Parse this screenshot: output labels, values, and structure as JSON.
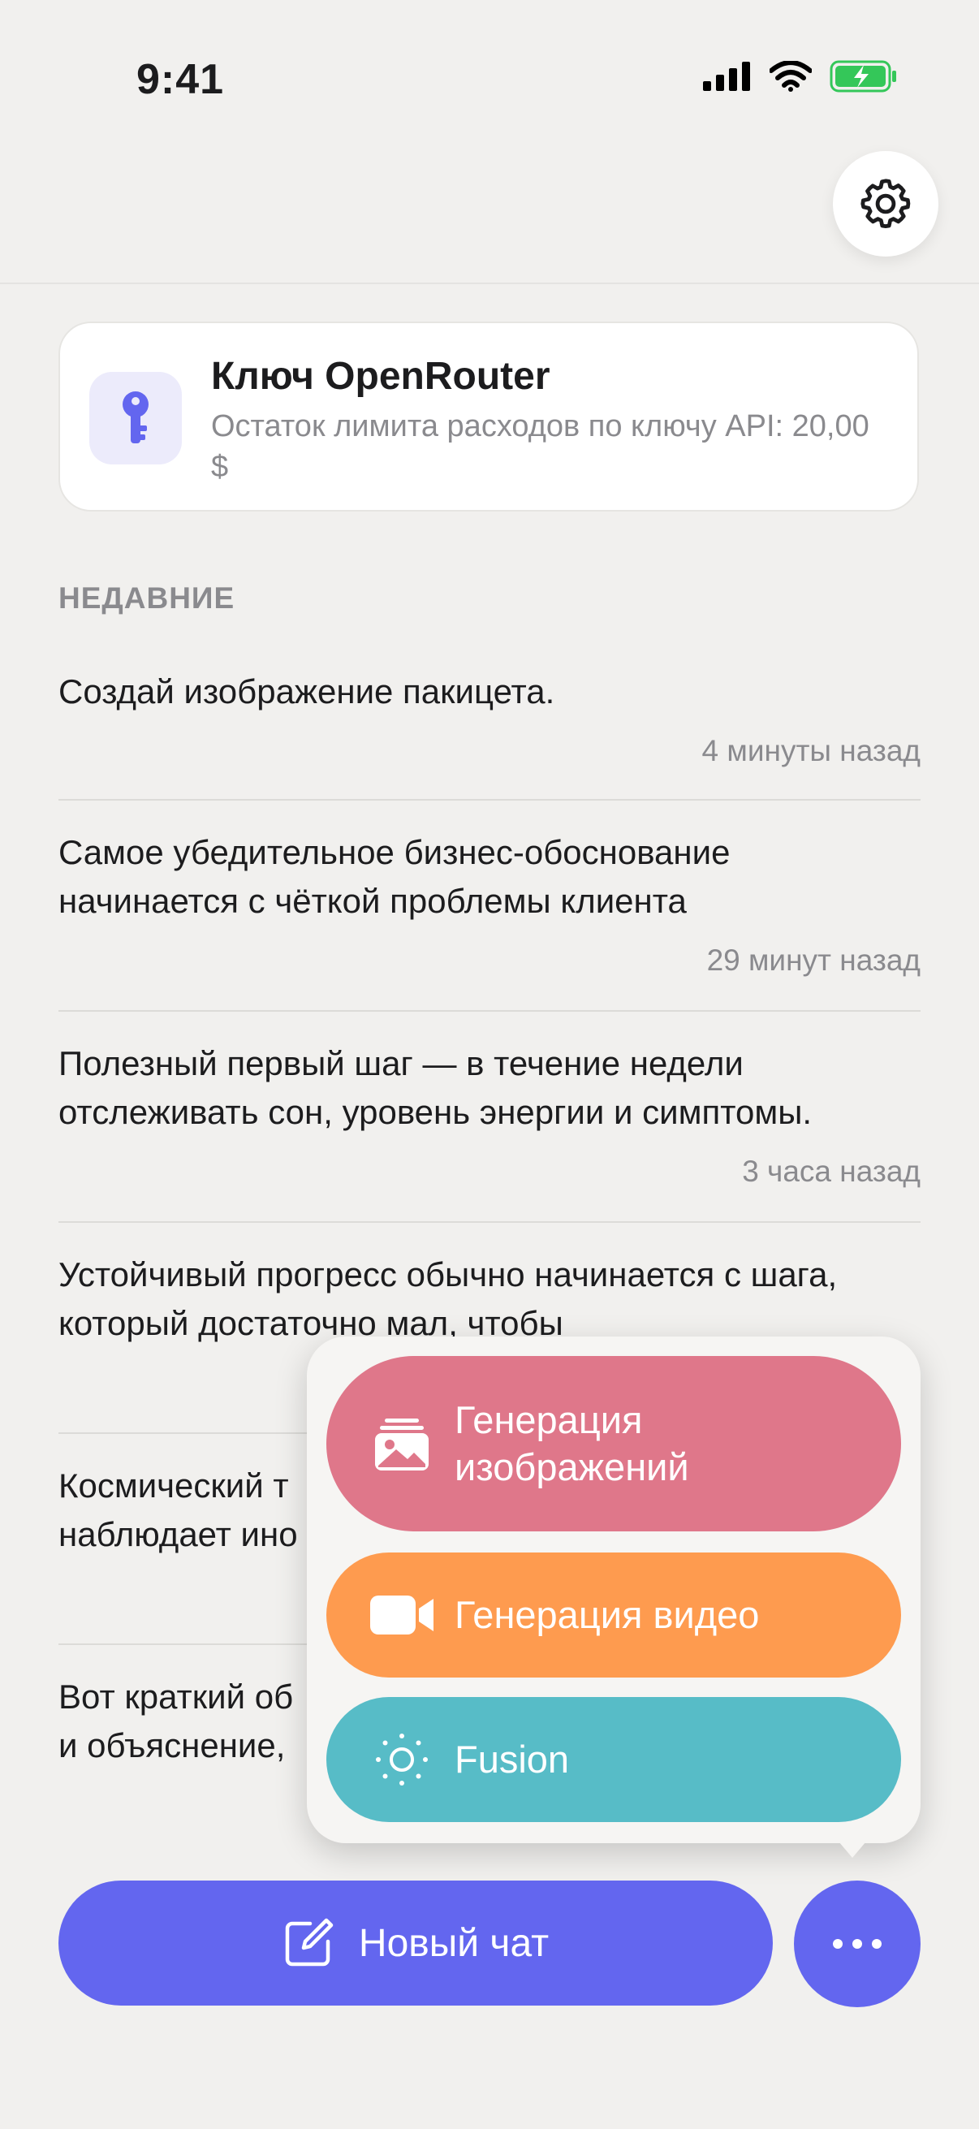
{
  "status": {
    "time": "9:41"
  },
  "key_card": {
    "title": "Ключ OpenRouter",
    "subtitle": "Остаток лимита расходов по ключу API: 20,00 $"
  },
  "recent": {
    "label": "НЕДАВНИЕ",
    "items": [
      {
        "text": "Создай изображение пакицета.",
        "time": "4 минуты назад"
      },
      {
        "text": "Самое убедительное бизнес-обоснование начинается с чёткой проблемы клиента",
        "time": "29 минут назад"
      },
      {
        "text": "Полезный первый шаг — в течение недели отслеживать сон, уровень энергии и симптомы.",
        "time": "3 часа назад"
      },
      {
        "text": "Устойчивый прогресс обычно начинается с шага, который достаточно мал, чтобы",
        "time": ""
      },
      {
        "text": "Космический т наблюдает ино",
        "time": ""
      },
      {
        "text": "Вот краткий об и объяснение,",
        "time": ""
      }
    ]
  },
  "menu": {
    "image_gen": "Генерация изображений",
    "video_gen": "Генерация видео",
    "fusion": "Fusion"
  },
  "bottom": {
    "new_chat": "Новый чат"
  },
  "colors": {
    "accent": "#6366ef",
    "image_gen": "#df778a",
    "video_gen": "#fe9b4f",
    "fusion": "#57bcc7",
    "battery": "#34c759"
  },
  "icons": {
    "settings": "gear-icon",
    "key": "key-icon",
    "image_gen": "image-stack-icon",
    "video_gen": "video-camera-icon",
    "fusion": "sun-icon",
    "new_chat": "compose-icon",
    "more": "ellipsis-icon"
  }
}
